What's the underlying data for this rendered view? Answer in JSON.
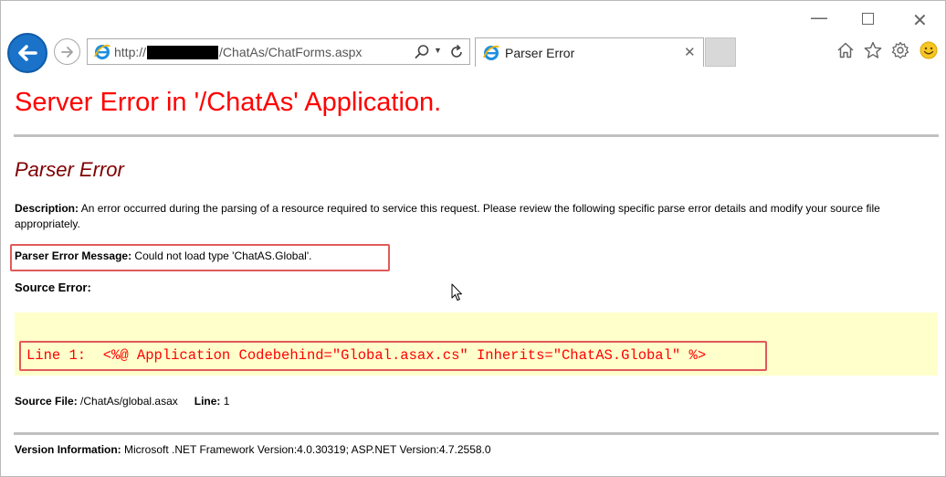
{
  "window": {
    "min_glyph": "—",
    "close_glyph": "✕"
  },
  "address_bar": {
    "url_prefix": "http://",
    "url_path": "/ChatAs/ChatForms.aspx"
  },
  "tab": {
    "title": "Parser Error",
    "close_glyph": "✕"
  },
  "toolbar_icons": [
    "home-icon",
    "star-icon",
    "gear-icon",
    "smiley-icon"
  ],
  "page": {
    "heading": "Server Error in '/ChatAs' Application.",
    "subheading": "Parser Error",
    "description_label": "Description:",
    "description_text": " An error occurred during the parsing of a resource required to service this request. Please review the following specific parse error details and modify your source file appropriately.",
    "parser_message_label": "Parser Error Message:",
    "parser_message_text": " Could not load type 'ChatAS.Global'.",
    "source_error_label": "Source Error:",
    "code_line": "Line 1:  <%@ Application Codebehind=\"Global.asax.cs\" Inherits=\"ChatAS.Global\" %>",
    "source_file_label": "Source File:",
    "source_file_value": " /ChatAs/global.asax",
    "line_label": "Line:",
    "line_value": " 1",
    "version_label": "Version Information:",
    "version_text": " Microsoft .NET Framework Version:4.0.30319; ASP.NET Version:4.7.2558.0"
  },
  "colors": {
    "heading_red": "#ff0000",
    "subheading_maroon": "#800000",
    "code_bg": "#ffffcc",
    "highlight_border": "#e05a5a",
    "back_button_blue": "#1a73c9"
  }
}
